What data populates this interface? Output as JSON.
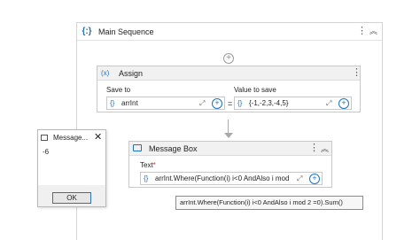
{
  "sequence": {
    "title": "Main Sequence",
    "more_glyph": "⋮",
    "collapse_glyph": "︽"
  },
  "assign": {
    "title": "Assign",
    "icon_text": "(x)",
    "more_glyph": "⋮",
    "save_to_label": "Value to save",
    "save_to_caption": "Save to",
    "save_to_value": "arrInt",
    "equals": "=",
    "value_to_save": "{-1,-2,3,-4,5}"
  },
  "message_box": {
    "title": "Message Box",
    "more_glyph": "⋮",
    "collapse_glyph": "︽",
    "text_label": "Text",
    "required_mark": "*",
    "text_value": "arrInt.Where(Function(i) i<0 AndAlso i mod"
  },
  "tooltip": {
    "text": "arrInt.Where(Function(i) i<0 AndAlso i mod 2 =0).Sum()"
  },
  "dialog": {
    "title": "Message...",
    "close_glyph": "✕",
    "message": "-6",
    "ok_label": "OK"
  },
  "icons": {
    "brace": "{}",
    "expand": "⤢",
    "add": "+",
    "plus": "+"
  },
  "colors": {
    "accent": "#1a73c8",
    "border": "#c9c9c9",
    "header_bg": "#f1f1f1"
  }
}
